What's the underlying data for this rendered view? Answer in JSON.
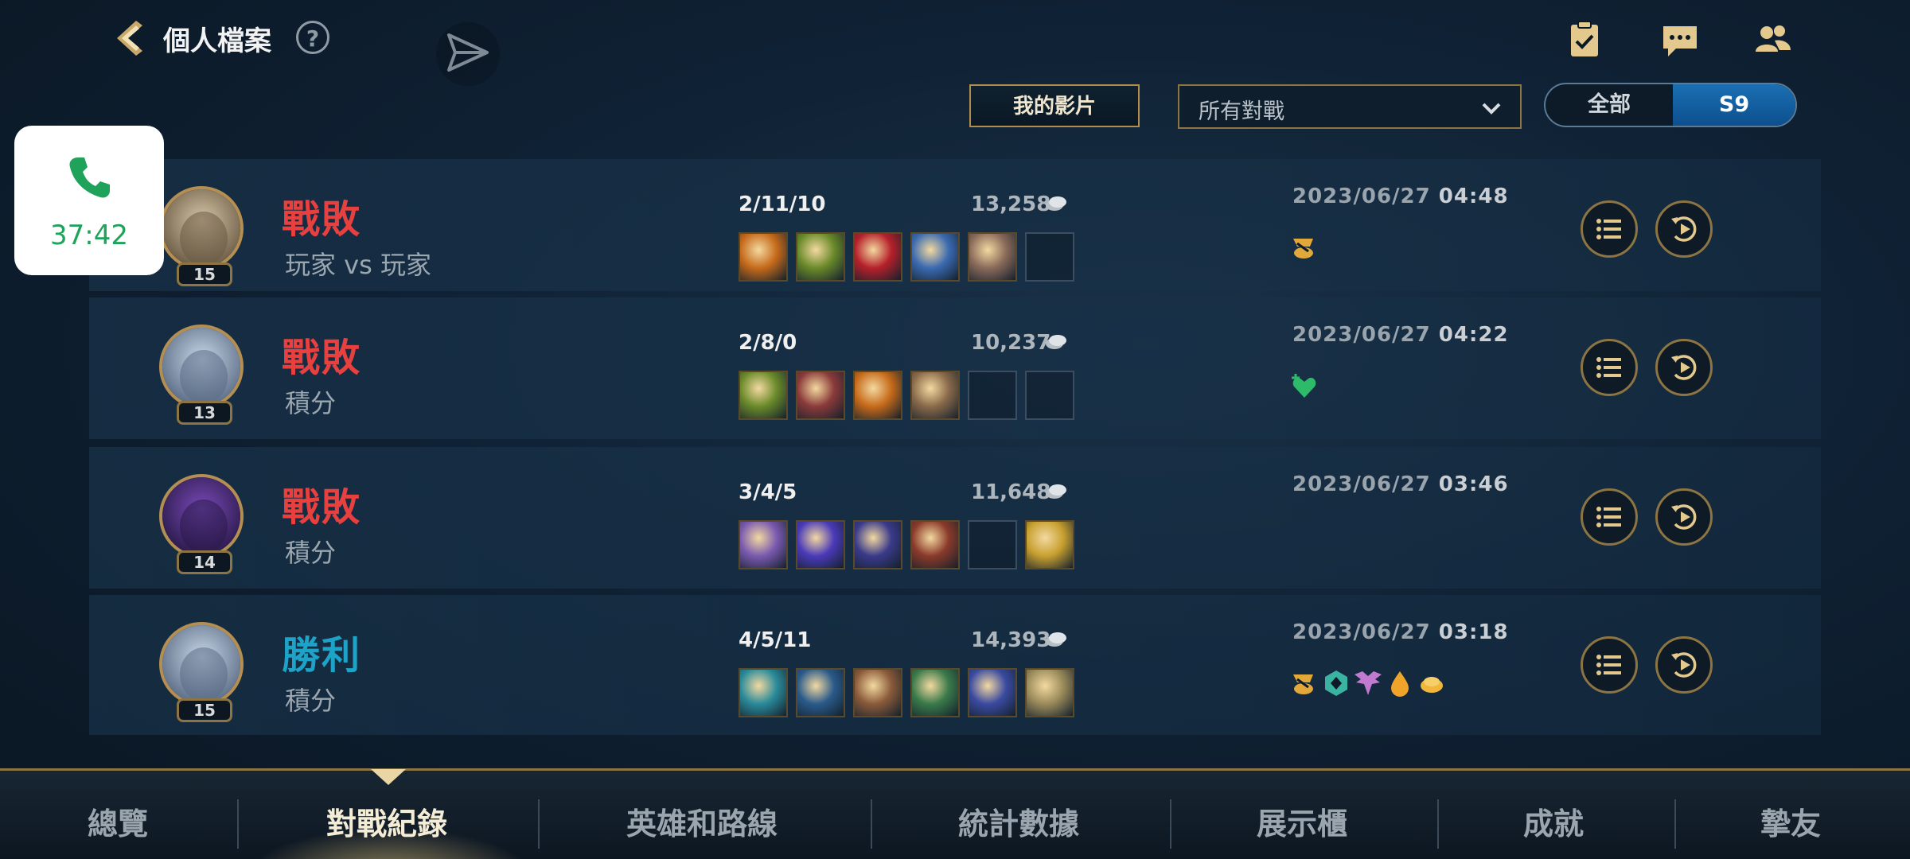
{
  "header": {
    "title": "個人檔案",
    "help_label": "?"
  },
  "filters": {
    "my_videos_label": "我的影片",
    "mode_selected": "所有對戰",
    "season_all": "全部",
    "season_s9": "S9"
  },
  "call": {
    "duration": "37:42"
  },
  "matches": [
    {
      "level": "15",
      "result": "戰敗",
      "mode": "玩家 vs 玩家",
      "kda": "2/11/10",
      "gold": "13,258",
      "date": "2023/06/27",
      "time": "04:48",
      "items": [
        "#c66a1a",
        "#6a8a2a",
        "#b5202a",
        "#3a6ab0",
        "#8a6a5a",
        "empty"
      ],
      "badges": [
        "gold-badge"
      ]
    },
    {
      "level": "13",
      "result": "戰敗",
      "mode": "積分",
      "kda": "2/8/0",
      "gold": "10,237",
      "date": "2023/06/27",
      "time": "04:22",
      "items": [
        "#6a8a2a",
        "#8a3a3a",
        "#c66a1a",
        "#8a6a4a",
        "empty",
        "empty"
      ],
      "badges": [
        "heal-badge"
      ]
    },
    {
      "level": "14",
      "result": "戰敗",
      "mode": "積分",
      "kda": "3/4/5",
      "gold": "11,648",
      "date": "2023/06/27",
      "time": "03:46",
      "items": [
        "#7a5ab0",
        "#4a3ab8",
        "#3a3a8a",
        "#8a3a2a",
        "empty",
        "#c8a030"
      ],
      "badges": []
    },
    {
      "level": "15",
      "result": "勝利",
      "mode": "積分",
      "kda": "4/5/11",
      "gold": "14,393",
      "date": "2023/06/27",
      "time": "03:18",
      "items": [
        "#2a8a9a",
        "#2a5a8a",
        "#8a5a3a",
        "#3a7a4a",
        "#3a4aa0",
        "#9a8a5a"
      ],
      "badges": [
        "gold-badge",
        "shield-badge",
        "wings-badge",
        "drop-badge",
        "coin-badge"
      ]
    }
  ],
  "tabs": [
    "總覽",
    "對戰紀錄",
    "英雄和路線",
    "統計數據",
    "展示櫃",
    "成就",
    "摯友"
  ],
  "colors": {
    "defeat": "#e8403f",
    "victory": "#1ea3c8",
    "gold_frame": "#8c7443"
  }
}
